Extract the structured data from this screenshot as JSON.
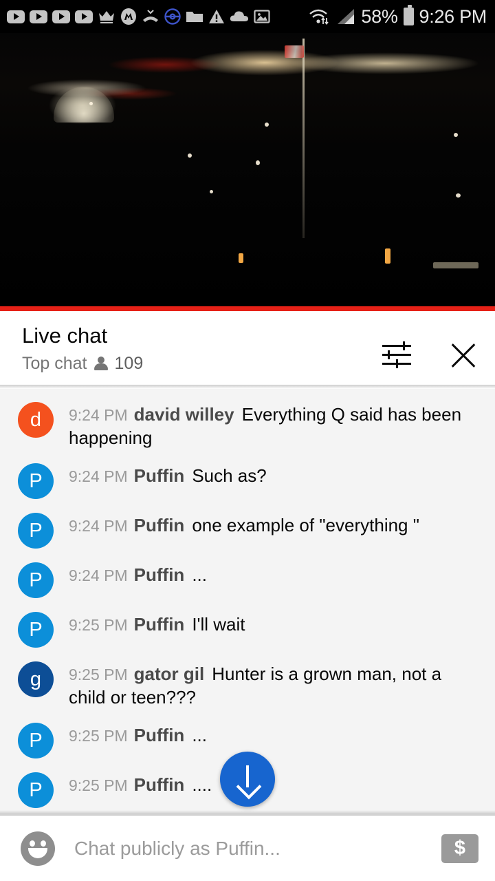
{
  "status_bar": {
    "notification_icons": [
      "youtube-icon",
      "youtube-icon",
      "youtube-icon",
      "youtube-icon",
      "crown-icon",
      "messenger-icon",
      "missed-call-icon",
      "pokeball-icon",
      "folder-icon",
      "warning-icon",
      "cloud-icon",
      "photo-icon"
    ],
    "wifi_icon": "wifi-icon",
    "signal_icon": "signal-icon",
    "battery_percent": "58%",
    "battery_icon": "battery-icon",
    "clock": "9:26 PM"
  },
  "video": {
    "description": "night cityscape live stream",
    "progress_color": "#e62117"
  },
  "chat_header": {
    "title": "Live chat",
    "mode": "Top chat",
    "viewer_count": "109",
    "viewer_icon": "person-icon",
    "settings_icon": "tune-icon",
    "close_icon": "close-icon"
  },
  "messages": [
    {
      "time": "9:24 PM",
      "author": "david willey",
      "text": "Everything Q said has been happening",
      "initial": "d",
      "color": "#f4511e"
    },
    {
      "time": "9:24 PM",
      "author": "Puffin",
      "text": "Such as?",
      "initial": "P",
      "color": "#0c8fd9"
    },
    {
      "time": "9:24 PM",
      "author": "Puffin",
      "text": "one example of \"everything \"",
      "initial": "P",
      "color": "#0c8fd9"
    },
    {
      "time": "9:24 PM",
      "author": "Puffin",
      "text": "...",
      "initial": "P",
      "color": "#0c8fd9"
    },
    {
      "time": "9:25 PM",
      "author": "Puffin",
      "text": "I'll wait",
      "initial": "P",
      "color": "#0c8fd9"
    },
    {
      "time": "9:25 PM",
      "author": "gator gil",
      "text": "Hunter is a grown man, not a child or teen???",
      "initial": "g",
      "color": "#0d4e96"
    },
    {
      "time": "9:25 PM",
      "author": "Puffin",
      "text": "...",
      "initial": "P",
      "color": "#0c8fd9"
    },
    {
      "time": "9:25 PM",
      "author": "Puffin",
      "text": "....",
      "initial": "P",
      "color": "#0c8fd9"
    }
  ],
  "scroll_to_bottom": {
    "icon": "arrow-down-icon",
    "color": "#1765cf"
  },
  "input_bar": {
    "emoji_icon": "emoji-icon",
    "placeholder": "Chat publicly as Puffin...",
    "value": "",
    "superchat_icon": "dollar-icon",
    "superchat_label": "$"
  }
}
